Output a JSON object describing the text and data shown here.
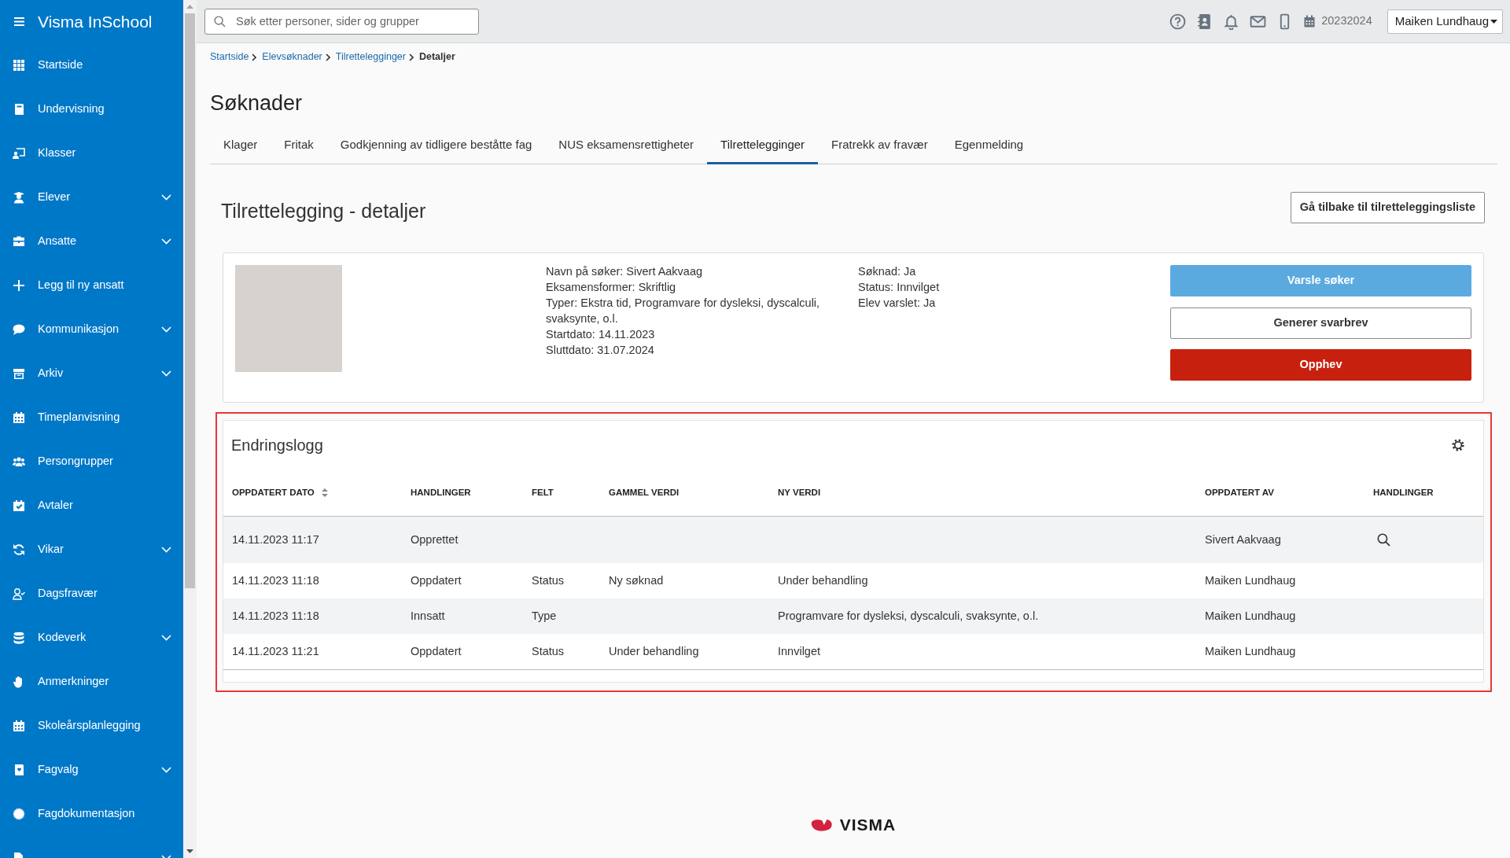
{
  "sidebar": {
    "title": "Visma InSchool",
    "items": [
      {
        "label": "Startside",
        "has_submenu": false,
        "selected": false
      },
      {
        "label": "Undervisning",
        "has_submenu": false,
        "selected": false
      },
      {
        "label": "Klasser",
        "has_submenu": false,
        "selected": false
      },
      {
        "label": "Elever",
        "has_submenu": true,
        "selected": false
      },
      {
        "label": "Ansatte",
        "has_submenu": true,
        "selected": false
      },
      {
        "label": "Legg til ny ansatt",
        "has_submenu": false,
        "selected": false
      },
      {
        "label": "Kommunikasjon",
        "has_submenu": true,
        "selected": false
      },
      {
        "label": "Arkiv",
        "has_submenu": true,
        "selected": false
      },
      {
        "label": "Timeplanvisning",
        "has_submenu": false,
        "selected": false
      },
      {
        "label": "Persongrupper",
        "has_submenu": false,
        "selected": false
      },
      {
        "label": "Avtaler",
        "has_submenu": false,
        "selected": false
      },
      {
        "label": "Vikar",
        "has_submenu": true,
        "selected": false
      },
      {
        "label": "Dagsfravær",
        "has_submenu": false,
        "selected": false
      },
      {
        "label": "Kodeverk",
        "has_submenu": true,
        "selected": false
      },
      {
        "label": "Anmerkninger",
        "has_submenu": false,
        "selected": false
      },
      {
        "label": "Skoleårsplanlegging",
        "has_submenu": false,
        "selected": false
      },
      {
        "label": "Fagvalg",
        "has_submenu": true,
        "selected": false
      },
      {
        "label": "Fagdokumentasjon",
        "has_submenu": false,
        "selected": false
      },
      {
        "has_submenu": true,
        "selected": false
      }
    ]
  },
  "top_bar": {
    "search": {
      "placeholder": "Søk etter personer, sider og grupper"
    },
    "school_year": "20232024",
    "user": "Maiken Lundhaug"
  },
  "breadcrumb": [
    {
      "label": "Startside",
      "current": false
    },
    {
      "label": "Elevsøknader",
      "current": false
    },
    {
      "label": "Tilrettelegginger",
      "current": false
    },
    {
      "label": "Detaljer",
      "current": true
    }
  ],
  "page_title": "Søknader",
  "tabs": [
    {
      "label": "Klager",
      "selected": false
    },
    {
      "label": "Fritak",
      "selected": false
    },
    {
      "label": "Godkjenning av tidligere beståtte fag",
      "selected": false
    },
    {
      "label": "NUS eksamensrettigheter",
      "selected": false
    },
    {
      "label": "Tilrettelegginger",
      "selected": true
    },
    {
      "label": "Fratrekk av fravær",
      "selected": false
    },
    {
      "label": "Egenmelding",
      "selected": false
    }
  ],
  "details": {
    "title": "Tilrettelegging - detaljer",
    "back_button": "Gå tilbake til tilretteleggingsliste",
    "applicant_info": [
      "Navn på søker: Sivert Aakvaag",
      "Eksamensformer: Skriftlig",
      "Typer: Ekstra tid, Programvare for dysleksi, dyscalculi, svaksynte, o.l.",
      "Startdato: 14.11.2023",
      "Sluttdato: 31.07.2024"
    ],
    "status_info": [
      "Søknad: Ja",
      "Status: Innvilget",
      "Elev varslet: Ja"
    ],
    "buttons": [
      {
        "label": "Varsle søker",
        "kind": "info"
      },
      {
        "label": "Generer svarbrev",
        "kind": "outline"
      },
      {
        "label": "Opphev",
        "kind": "danger"
      }
    ]
  },
  "change_log": {
    "title": "Endringslogg",
    "highlighted": true,
    "columns": [
      {
        "label": "OPPDATERT DATO",
        "sortable": true
      },
      {
        "label": "HANDLINGER",
        "sortable": false
      },
      {
        "label": "FELT",
        "sortable": false
      },
      {
        "label": "GAMMEL VERDI",
        "sortable": false
      },
      {
        "label": "NY VERDI",
        "sortable": false
      },
      {
        "label": "OPPDATERT AV",
        "sortable": false
      },
      {
        "label": "HANDLINGER",
        "sortable": false
      }
    ],
    "rows": [
      {
        "updated_date": "14.11.2023 11:17",
        "action": "Opprettet",
        "updated_by": "Sivert Aakvaag",
        "view": true
      },
      {
        "updated_date": "14.11.2023 11:18",
        "action": "Oppdatert",
        "field": "Status",
        "old_value": "Ny søknad",
        "new_value": "Under behandling",
        "updated_by": "Maiken Lundhaug",
        "view": false
      },
      {
        "updated_date": "14.11.2023 11:18",
        "action": "Innsatt",
        "field": "Type",
        "new_value": "Programvare for dysleksi, dyscalculi, svaksynte, o.l.",
        "updated_by": "Maiken Lundhaug",
        "view": false
      },
      {
        "updated_date": "14.11.2023 11:21",
        "action": "Oppdatert",
        "field": "Status",
        "old_value": "Under behandling",
        "new_value": "Innvilget",
        "updated_by": "Maiken Lundhaug",
        "view": false
      }
    ]
  },
  "footer": {
    "logo_text": "VISMA"
  }
}
